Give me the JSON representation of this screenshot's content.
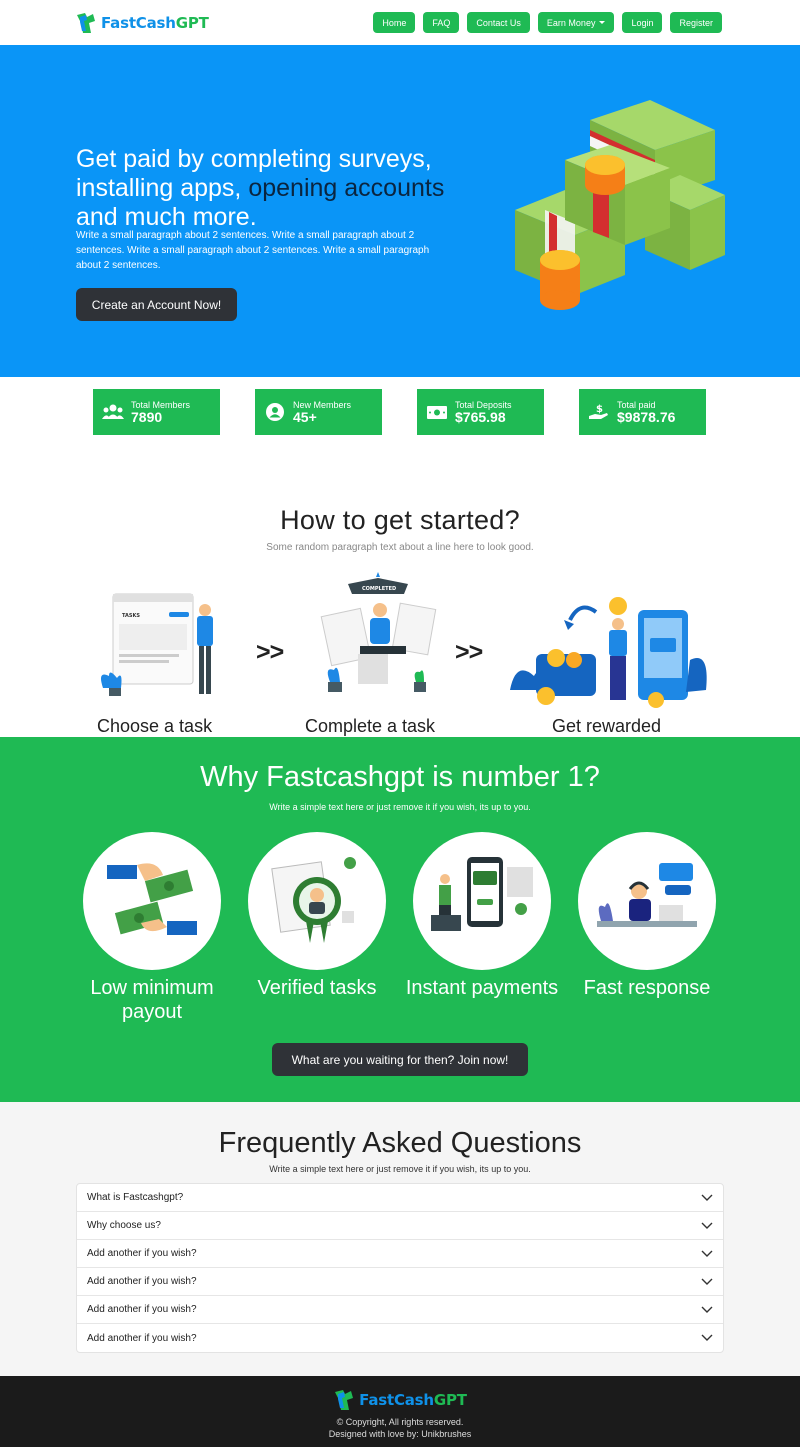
{
  "nav": {
    "logo_part1": "FastCash",
    "logo_part2": "GPT",
    "links": [
      "Home",
      "FAQ",
      "Contact Us",
      "Earn Money",
      "Login",
      "Register"
    ]
  },
  "hero": {
    "title_part1": "Get paid by completing surveys, installing apps,",
    "title_part2": "opening accounts",
    "title_part3": " and much more.",
    "text": "Write a small paragraph about 2 sentences. Write a small paragraph about 2 sentences. Write a small paragraph about 2 sentences. Write a small paragraph about 2 sentences.",
    "cta": "Create an Account Now!"
  },
  "stats": [
    {
      "label": "Total Members",
      "value": "7890",
      "icon": "users-icon"
    },
    {
      "label": "New Members",
      "value": "45+",
      "icon": "user-circle-icon"
    },
    {
      "label": "Total Deposits",
      "value": "$765.98",
      "icon": "money-bill-icon"
    },
    {
      "label": "Total paid",
      "value": "$9878.76",
      "icon": "hand-dollar-icon"
    }
  ],
  "how": {
    "title": "How to get started?",
    "subtitle": "Some random paragraph text about a line here to look good.",
    "steps": [
      "Choose a task",
      "Complete a task",
      "Get rewarded"
    ],
    "arrow": ">>",
    "tasks_label": "TASKS",
    "completed_label": "COMPLETED"
  },
  "why": {
    "title": "Why Fastcashgpt is number 1?",
    "subtitle": "Write a simple text here or just remove it if you wish, its up to you.",
    "features": [
      "Low minimum payout",
      "Verified tasks",
      "Instant payments",
      "Fast response"
    ],
    "cta": "What are you waiting for then? Join now!"
  },
  "faq": {
    "title": "Frequently Asked Questions",
    "subtitle": "Write a simple text here or just remove it if you wish, its up to you.",
    "items": [
      "What is Fastcashgpt?",
      "Why choose us?",
      "Add another if you wish?",
      "Add another if you wish?",
      "Add another if you wish?",
      "Add another if you wish?"
    ]
  },
  "footer": {
    "logo_part1": "FastCash",
    "logo_part2": "GPT",
    "copyright": "© Copyright, All rights reserved.",
    "credit": "Designed with love by: Unikbrushes"
  },
  "colors": {
    "brand_blue": "#0a95f7",
    "brand_green": "#1fba54",
    "dark_button": "#2f3237",
    "footer_bg": "#1b1b1b"
  }
}
